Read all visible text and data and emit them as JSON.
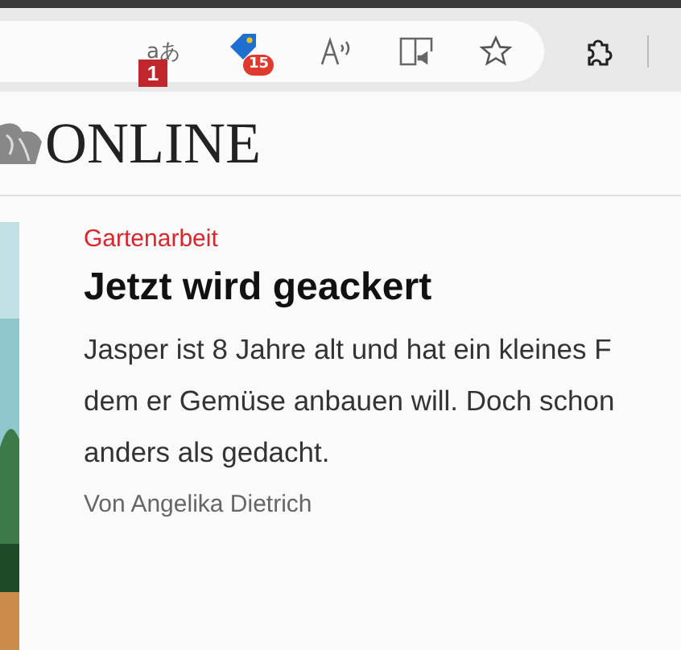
{
  "toolbar": {
    "translate_icon_glyph": "aあ",
    "callout_marker": "1",
    "coupon_badge": "15"
  },
  "site": {
    "logo_text": "ONLINE"
  },
  "article": {
    "category": "Gartenarbeit",
    "headline": "Jetzt wird geackert",
    "teaser_lines": [
      "Jasper ist 8 Jahre alt und hat ein kleines F",
      "dem er Gemüse anbauen will. Doch schon",
      "anders als gedacht."
    ],
    "byline": "Von Angelika Dietrich"
  }
}
